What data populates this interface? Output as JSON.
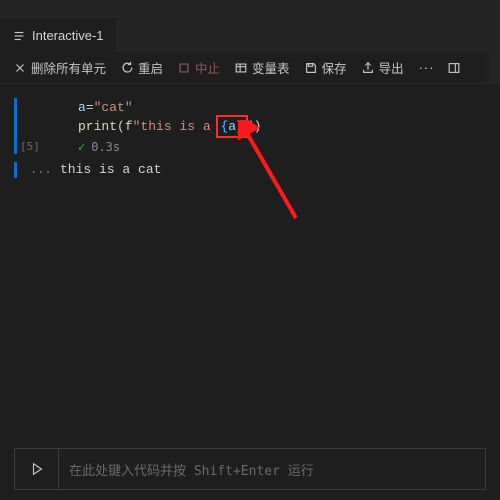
{
  "tab": {
    "title": "Interactive-1"
  },
  "toolbar": {
    "clear_all": "删除所有单元",
    "restart": "重启",
    "stop": "中止",
    "variables": "变量表",
    "save": "保存",
    "export": "导出",
    "more": "···"
  },
  "cell": {
    "exec_label": "[5]",
    "line1_var": "a",
    "line1_eq": "=",
    "line1_str": "\"cat\"",
    "line2_fn": "print",
    "line2_pfx": "(f",
    "line2_str_open": "\"this is a ",
    "line2_interp_open": "{",
    "line2_interp_var": "a",
    "line2_interp_close": "}",
    "line2_str_close": "\"",
    "line2_sfx": ")",
    "status_time": "0.3s"
  },
  "output": {
    "marker": "...",
    "text": "this is a cat"
  },
  "input": {
    "placeholder": "在此处键入代码并按 Shift+Enter 运行"
  }
}
